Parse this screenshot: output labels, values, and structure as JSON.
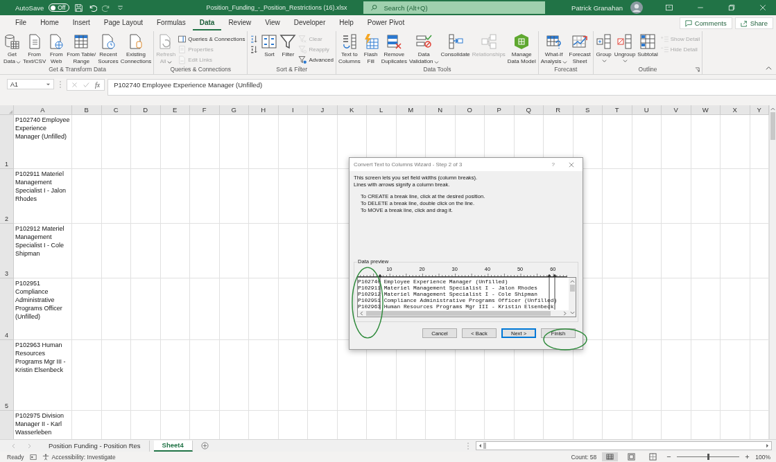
{
  "title_bar": {
    "autosave_label": "AutoSave",
    "autosave_state": "Off",
    "autosave_on": false,
    "filename": "Position_Funding_-_Position_Restrictions (16).xlsx",
    "search_placeholder": "Search (Alt+Q)",
    "user": "Patrick Granahan"
  },
  "ribbon_tabs": [
    {
      "label": "File",
      "selected": false
    },
    {
      "label": "Home",
      "selected": false
    },
    {
      "label": "Insert",
      "selected": false
    },
    {
      "label": "Page Layout",
      "selected": false
    },
    {
      "label": "Formulas",
      "selected": false
    },
    {
      "label": "Data",
      "selected": true
    },
    {
      "label": "Review",
      "selected": false
    },
    {
      "label": "View",
      "selected": false
    },
    {
      "label": "Developer",
      "selected": false
    },
    {
      "label": "Help",
      "selected": false
    },
    {
      "label": "Power Pivot",
      "selected": false
    }
  ],
  "comments_button": "Comments",
  "share_button": "Share",
  "ribbon_groups": [
    {
      "label": "Get & Transform Data",
      "entries": [
        {
          "kind": "large",
          "lines": [
            "Get",
            "Data"
          ],
          "dropdown": true,
          "disabled": false
        },
        {
          "kind": "large",
          "lines": [
            "From",
            "Text/CSV"
          ],
          "dropdown": false,
          "disabled": false
        },
        {
          "kind": "large",
          "lines": [
            "From",
            "Web"
          ],
          "dropdown": false,
          "disabled": false
        },
        {
          "kind": "large",
          "lines": [
            "From Table/",
            "Range"
          ],
          "dropdown": false,
          "disabled": false
        },
        {
          "kind": "large",
          "lines": [
            "Recent",
            "Sources"
          ],
          "dropdown": false,
          "disabled": false
        },
        {
          "kind": "large",
          "lines": [
            "Existing",
            "Connections"
          ],
          "dropdown": false,
          "disabled": false
        }
      ]
    },
    {
      "label": "Queries & Connections",
      "entries": [
        {
          "kind": "large",
          "lines": [
            "Refresh",
            "All"
          ],
          "dropdown": true,
          "disabled": true
        },
        {
          "kind": "stack",
          "items": [
            {
              "label": "Queries & Connections",
              "disabled": false
            },
            {
              "label": "Properties",
              "disabled": true
            },
            {
              "label": "Edit Links",
              "disabled": true
            }
          ]
        }
      ]
    },
    {
      "label": "Sort & Filter",
      "entries": [
        {
          "kind": "stack",
          "items": [
            {
              "disabled": false
            },
            {
              "disabled": false
            }
          ]
        },
        {
          "kind": "large",
          "lines": [
            "Sort"
          ],
          "dropdown": false,
          "disabled": false
        },
        {
          "kind": "large",
          "lines": [
            "Filter"
          ],
          "dropdown": false,
          "disabled": false
        },
        {
          "kind": "stack",
          "items": [
            {
              "label": "Clear",
              "disabled": true
            },
            {
              "label": "Reapply",
              "disabled": true
            },
            {
              "label": "Advanced",
              "disabled": false
            }
          ]
        }
      ]
    },
    {
      "label": "Data Tools",
      "entries": [
        {
          "kind": "large",
          "lines": [
            "Text to",
            "Columns"
          ],
          "dropdown": false,
          "disabled": false
        },
        {
          "kind": "large",
          "lines": [
            "Flash",
            "Fill"
          ],
          "dropdown": false,
          "disabled": false
        },
        {
          "kind": "large",
          "lines": [
            "Remove",
            "Duplicates"
          ],
          "dropdown": false,
          "disabled": false
        },
        {
          "kind": "large",
          "lines": [
            "Data",
            "Validation"
          ],
          "dropdown": true,
          "disabled": false
        },
        {
          "kind": "large",
          "lines": [
            "Consolidate"
          ],
          "dropdown": false,
          "disabled": false
        },
        {
          "kind": "large",
          "lines": [
            "Relationships"
          ],
          "dropdown": false,
          "disabled": true
        },
        {
          "kind": "large",
          "lines": [
            "Manage",
            "Data Model"
          ],
          "dropdown": false,
          "disabled": false
        }
      ]
    },
    {
      "label": "Forecast",
      "entries": [
        {
          "kind": "large",
          "lines": [
            "What-If",
            "Analysis"
          ],
          "dropdown": true,
          "disabled": false
        },
        {
          "kind": "large",
          "lines": [
            "Forecast",
            "Sheet"
          ],
          "dropdown": false,
          "disabled": false
        }
      ]
    },
    {
      "label": "Outline",
      "entries": [
        {
          "kind": "large",
          "lines": [
            "Group"
          ],
          "dropdown": true,
          "disabled": false
        },
        {
          "kind": "large",
          "lines": [
            "Ungroup"
          ],
          "dropdown": true,
          "disabled": false
        },
        {
          "kind": "large",
          "lines": [
            "Subtotal"
          ],
          "dropdown": false,
          "disabled": false
        },
        {
          "kind": "stack",
          "items": [
            {
              "label": "Show Detail",
              "disabled": true
            },
            {
              "label": "Hide Detail",
              "disabled": true
            }
          ]
        }
      ]
    }
  ],
  "formula_bar": {
    "name_box": "A1",
    "function_label": "fx",
    "formula": "P102740 Employee Experience Manager (Unfilled)"
  },
  "columns": [
    "A",
    "B",
    "C",
    "D",
    "E",
    "F",
    "G",
    "H",
    "I",
    "J",
    "K",
    "L",
    "M",
    "N",
    "O",
    "P",
    "Q",
    "R",
    "S",
    "T",
    "U",
    "V",
    "W",
    "X",
    "Y"
  ],
  "rows": [
    {
      "number": "1",
      "cell": "P102740 Employee Experience Manager (Unfilled)"
    },
    {
      "number": "2",
      "cell": "P102911 Materiel Management Specialist I - Jalon Rhodes"
    },
    {
      "number": "3",
      "cell": "P102912 Materiel Management Specialist I - Cole Shipman"
    },
    {
      "number": "4",
      "cell": "P102951 Compliance Administrative Programs Officer (Unfilled)"
    },
    {
      "number": "5",
      "cell": "P102963 Human Resources Programs Mgr III - Kristin Elsenbeck"
    },
    {
      "cell": "P102975 Division Manager II - Karl Wasserleben"
    }
  ],
  "dialog": {
    "title": "Convert Text to Columns Wizard - Step 2 of 3",
    "help": "?",
    "intro": [
      "This screen lets you set field widths (column breaks).",
      "Lines with arrows signify a column break."
    ],
    "instructions": [
      "To CREATE a break line, click at the desired position.",
      "To DELETE a break line, double click on the line.",
      "To MOVE a break line, click and drag it."
    ],
    "preview_label": "Data preview",
    "ruler_labels": [
      "10",
      "20",
      "30",
      "40",
      "50",
      "60"
    ],
    "break_lines": [
      {
        "level": 0.11
      },
      {
        "level": 0.915
      },
      {
        "level": 0.94
      }
    ],
    "preview_lines": [
      "P102740 Employee Experience Manager (Unfilled)",
      "P102911 Materiel Management Specialist I - Jalon Rhodes",
      "P102912 Materiel Management Specialist I - Cole Shipman",
      "P102951 Compliance Administrative Programs Officer (Unfilled)",
      "P102963 Human Resources Programs Mgr III - Kristin Elsenbeck"
    ],
    "buttons": [
      {
        "label": "Cancel",
        "default": false
      },
      {
        "label": "< Back",
        "default": false
      },
      {
        "label": "Next >",
        "default": true
      },
      {
        "label": "Finish",
        "default": false
      }
    ]
  },
  "sheet_tabs": [
    {
      "label": "Position Funding - Position Res",
      "selected": false
    },
    {
      "label": "Sheet4",
      "selected": true
    }
  ],
  "status_bar": {
    "ready": "Ready",
    "accessibility": "Accessibility: Investigate",
    "count": "Count: 58",
    "zoom": "100%",
    "zoom_slider": {
      "level": 0.5
    }
  }
}
